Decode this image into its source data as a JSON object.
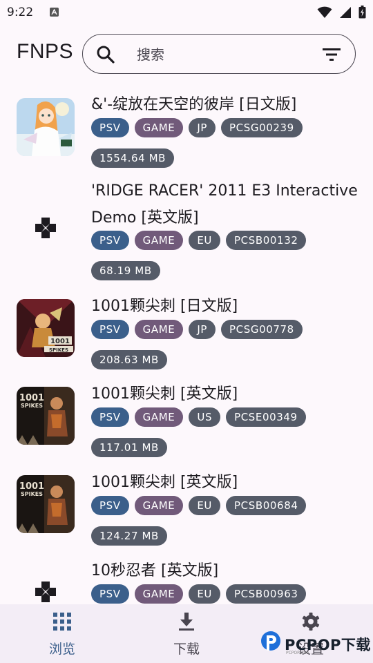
{
  "status_bar": {
    "time": "9:22",
    "notification_icon": "a-letter-icon"
  },
  "header": {
    "app_title": "FNPS"
  },
  "search": {
    "placeholder": "搜索",
    "value": ""
  },
  "games": [
    {
      "title": "&'-绽放在天空的彼岸 [日文版]",
      "platform": "PSV",
      "type": "GAME",
      "region": "JP",
      "id": "PCSG00239",
      "size": "1554.64 MB",
      "cover": "anime-girl-cover"
    },
    {
      "title": "'RIDGE RACER' 2011 E3 Interactive Demo [英文版]",
      "platform": "PSV",
      "type": "GAME",
      "region": "EU",
      "id": "PCSB00132",
      "size": "68.19 MB",
      "cover": "gamepad-placeholder-icon"
    },
    {
      "title": "1001颗尖刺 [日文版]",
      "platform": "PSV",
      "type": "GAME",
      "region": "JP",
      "id": "PCSG00778",
      "size": "208.63 MB",
      "cover": "1001-spikes-jp-cover"
    },
    {
      "title": "1001颗尖刺 [英文版]",
      "platform": "PSV",
      "type": "GAME",
      "region": "US",
      "id": "PCSE00349",
      "size": "117.01 MB",
      "cover": "1001-spikes-cover"
    },
    {
      "title": "1001颗尖刺 [英文版]",
      "platform": "PSV",
      "type": "GAME",
      "region": "EU",
      "id": "PCSB00684",
      "size": "124.27 MB",
      "cover": "1001-spikes-cover"
    },
    {
      "title": "10秒忍者 [英文版]",
      "platform": "PSV",
      "type": "GAME",
      "region": "EU",
      "id": "PCSB00963",
      "size": "",
      "cover": "gamepad-placeholder-icon"
    }
  ],
  "bottom_nav": [
    {
      "label": "浏览",
      "icon": "grid-icon",
      "active": true
    },
    {
      "label": "下载",
      "icon": "download-icon",
      "active": false
    },
    {
      "label": "设置",
      "icon": "gear-icon",
      "active": false
    }
  ],
  "watermark": {
    "text": "PCPOP下载",
    "sub": "PCPOP.com"
  },
  "colors": {
    "platform_chip": "#3b5f8b",
    "type_chip": "#715a7a",
    "neutral_chip": "#555b68",
    "background": "#fdf8fc",
    "nav_background": "#f3edf6"
  }
}
